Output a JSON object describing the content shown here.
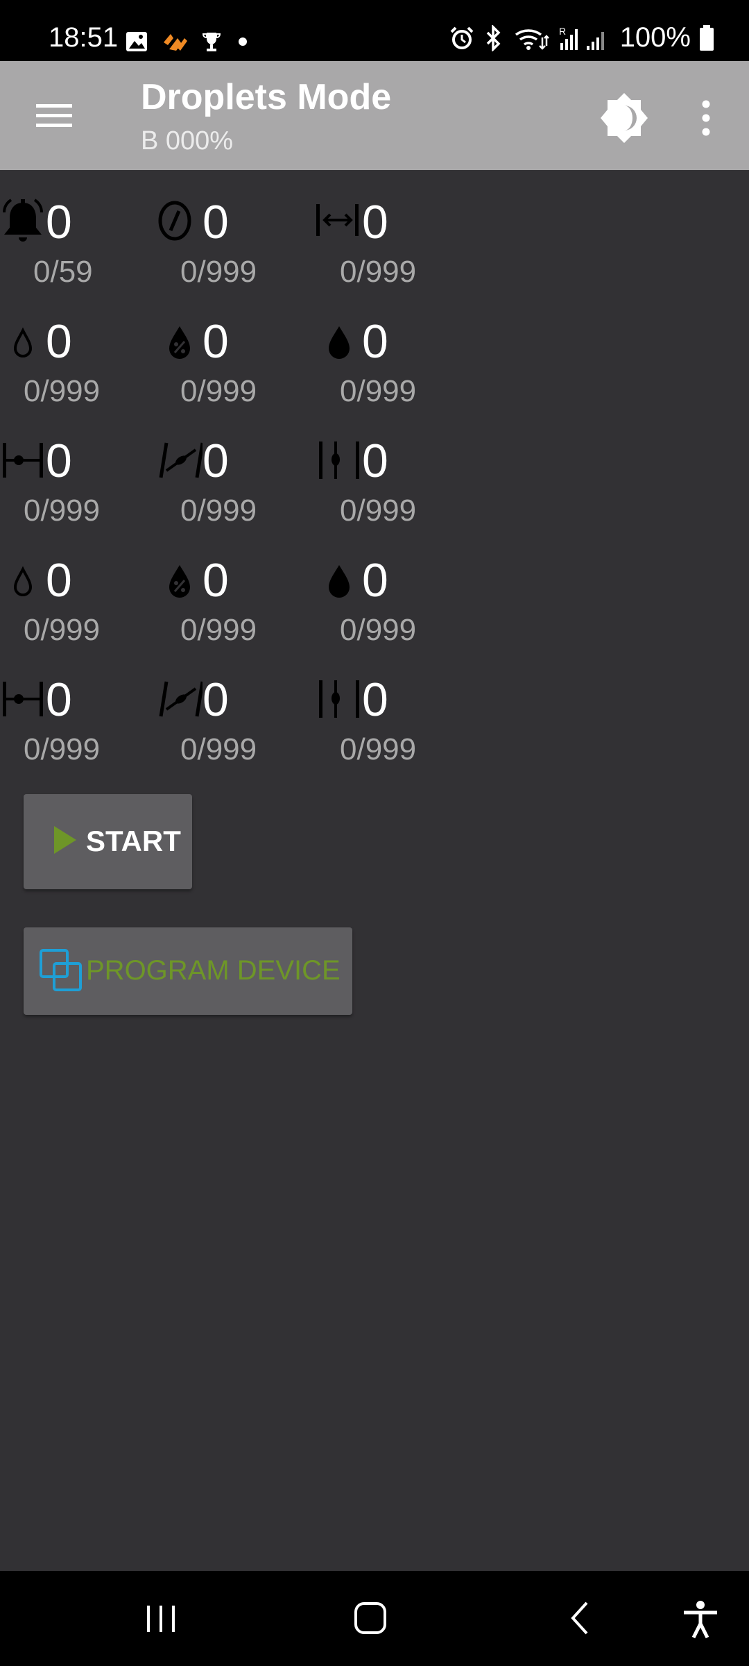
{
  "status_bar": {
    "time": "18:51",
    "battery": "100%",
    "left_icons": [
      "gallery-icon",
      "strava-icon",
      "trophy-icon",
      "dot-icon"
    ],
    "right_icons": [
      "alarm-icon",
      "bluetooth-icon",
      "wifi-icon",
      "signal-icon",
      "battery-icon"
    ]
  },
  "app_bar": {
    "title": "Droplets Mode",
    "subtitle": "B 000%",
    "icons": [
      "menu-icon",
      "brightness-icon",
      "more-vert-icon"
    ]
  },
  "grid": {
    "rows": [
      [
        {
          "icon": "bell-icon",
          "value": "0",
          "range": "0/59"
        },
        {
          "icon": "timer-icon",
          "value": "0",
          "range": "0/999"
        },
        {
          "icon": "width-icon",
          "value": "0",
          "range": "0/999"
        }
      ],
      [
        {
          "icon": "drop-outline-icon",
          "value": "0",
          "range": "0/999"
        },
        {
          "icon": "drop-percent-icon",
          "value": "0",
          "range": "0/999"
        },
        {
          "icon": "drop-filled-icon",
          "value": "0",
          "range": "0/999"
        }
      ],
      [
        {
          "icon": "gap-horizontal-icon",
          "value": "0",
          "range": "0/999"
        },
        {
          "icon": "gap-diagonal-icon",
          "value": "0",
          "range": "0/999"
        },
        {
          "icon": "gap-vertical-icon",
          "value": "0",
          "range": "0/999"
        }
      ],
      [
        {
          "icon": "drop-outline-icon",
          "value": "0",
          "range": "0/999"
        },
        {
          "icon": "drop-percent-icon",
          "value": "0",
          "range": "0/999"
        },
        {
          "icon": "drop-filled-icon",
          "value": "0",
          "range": "0/999"
        }
      ],
      [
        {
          "icon": "gap-horizontal-icon",
          "value": "0",
          "range": "0/999"
        },
        {
          "icon": "gap-diagonal-icon",
          "value": "0",
          "range": "0/999"
        },
        {
          "icon": "gap-vertical-icon",
          "value": "0",
          "range": "0/999"
        }
      ]
    ]
  },
  "buttons": {
    "start_label": "START",
    "program_label": "PROGRAM DEVICE"
  },
  "colors": {
    "accent_green": "#6e9628",
    "program_icon_blue": "#1e9fd6"
  }
}
